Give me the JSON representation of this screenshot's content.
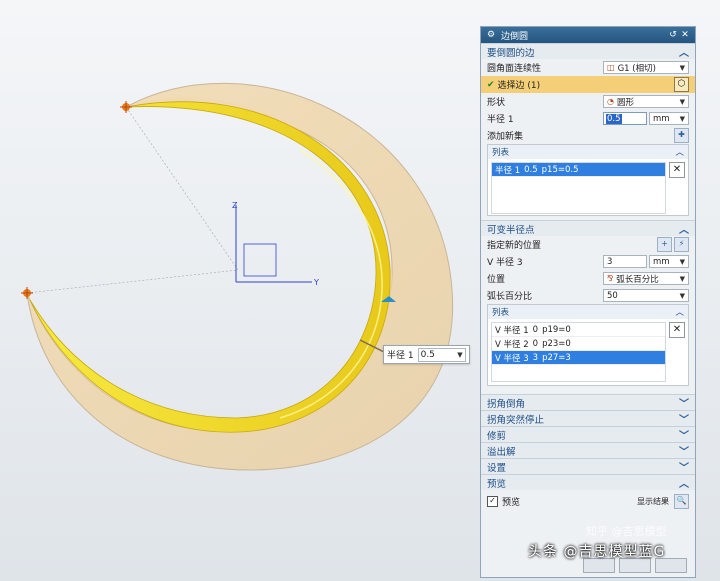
{
  "viewport": {
    "axis_labels": {
      "z": "Z",
      "y": "Y"
    },
    "floating_field": {
      "label": "半径 1",
      "value": "0.5"
    }
  },
  "dialog": {
    "title": "边倒圆",
    "sections": {
      "edges": {
        "header": "要倒圆的边",
        "continuity": {
          "label": "圆角面连续性",
          "value": "G1 (相切)"
        },
        "select_edge": {
          "label": "选择边 (1)"
        },
        "shape": {
          "label": "形状",
          "value": "圆形"
        },
        "radius": {
          "label": "半径 1",
          "value": "0.5",
          "unit": "mm"
        },
        "add_new_set": {
          "label": "添加新集"
        },
        "list": {
          "header": "列表",
          "rows": [
            {
              "c1": "半径 1",
              "c2": "0.5",
              "c3": "p15=0.5"
            }
          ]
        }
      },
      "variable_radius": {
        "header": "可变半径点",
        "new_location": {
          "label": "指定新的位置"
        },
        "v_radius": {
          "label": "V 半径 3",
          "value": "3",
          "unit": "mm"
        },
        "location": {
          "label": "位置",
          "value": "弧长百分比"
        },
        "arc_percent": {
          "label": "弧长百分比",
          "value": "50"
        },
        "list": {
          "header": "列表",
          "rows": [
            {
              "c1": "V 半径 1",
              "c2": "0",
              "c3": "p19=0"
            },
            {
              "c1": "V 半径 2",
              "c2": "0",
              "c3": "p23=0"
            },
            {
              "c1": "V 半径 3",
              "c2": "3",
              "c3": "p27=3"
            }
          ]
        }
      },
      "collapsed": [
        "拐角倒角",
        "拐角突然停止",
        "修剪",
        "溢出解",
        "设置"
      ],
      "preview": {
        "header": "预览",
        "checkbox_label": "预览",
        "show_result": "显示结果"
      }
    }
  },
  "watermark": {
    "text": "头条 @吉思模型蓝G",
    "faint": "知乎 @吉思模型"
  },
  "colors": {
    "title_bar": "#2a5d8a",
    "selection_row": "#f5cf77",
    "list_selected": "#2f7fe0",
    "fillet": "#f2e22a"
  }
}
